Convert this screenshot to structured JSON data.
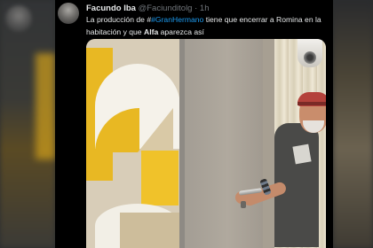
{
  "tweet": {
    "author_name": "Facundo Iba",
    "author_handle": "@Faciunditolg",
    "separator": "·",
    "time": "1h",
    "text_before": "La producción de #",
    "hashtag": "#GranHermano",
    "text_after": " tiene que encerrar a Romina en la habitación y que ",
    "bold_word": "Alfa",
    "text_end": " aparezca así"
  },
  "colors": {
    "background": "#000000",
    "hashtag": "#1d9bf0",
    "text_primary": "#e7e9ea",
    "text_secondary": "#71767b"
  }
}
